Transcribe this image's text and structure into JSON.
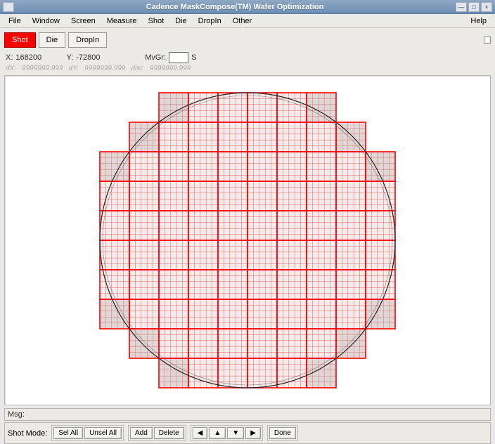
{
  "window": {
    "title": "Cadence MaskCompose(TM) Wafer Optimization"
  },
  "titlebar_buttons": {
    "min": "—",
    "max": "□",
    "close": "×"
  },
  "menu": {
    "items": [
      "File",
      "Window",
      "Screen",
      "Measure",
      "Shot",
      "Die",
      "DropIn",
      "Other"
    ],
    "help": "Help"
  },
  "tabs": {
    "shot": "Shot",
    "die": "Die",
    "dropin": "DropIn"
  },
  "coords": {
    "x_label": "X:",
    "x_value": "168200",
    "y_label": "Y:",
    "y_value": "-72800",
    "mvgr_label": "MvGr:",
    "mvgr_value": "",
    "mvgr_suffix": "S"
  },
  "deltas": {
    "dx_label": "dX:",
    "dx_value": "9999999.999",
    "dy_label": "dY:",
    "dy_value": "9999999.999",
    "dist_label": "dist:",
    "dist_value": "9999999.999"
  },
  "msg": {
    "label": "Msg:"
  },
  "mode": {
    "label": "Shot Mode:",
    "sel_all": "Sel All",
    "unsel_all": "Unsel All",
    "add": "Add",
    "delete": "Delete",
    "left": "◀",
    "up": "▲",
    "down": "▼",
    "right": "▶",
    "done": "Done"
  },
  "wafer": {
    "shot_cols": 10,
    "shot_rows": 10,
    "sub_cols": 5,
    "sub_rows": 5,
    "fill_color": "#f6eaea",
    "shot_line_color": "#ff0000",
    "sub_line_color": "#cc4444",
    "wafer_outline": "#222",
    "outside_fill": "#b9b0b0"
  }
}
